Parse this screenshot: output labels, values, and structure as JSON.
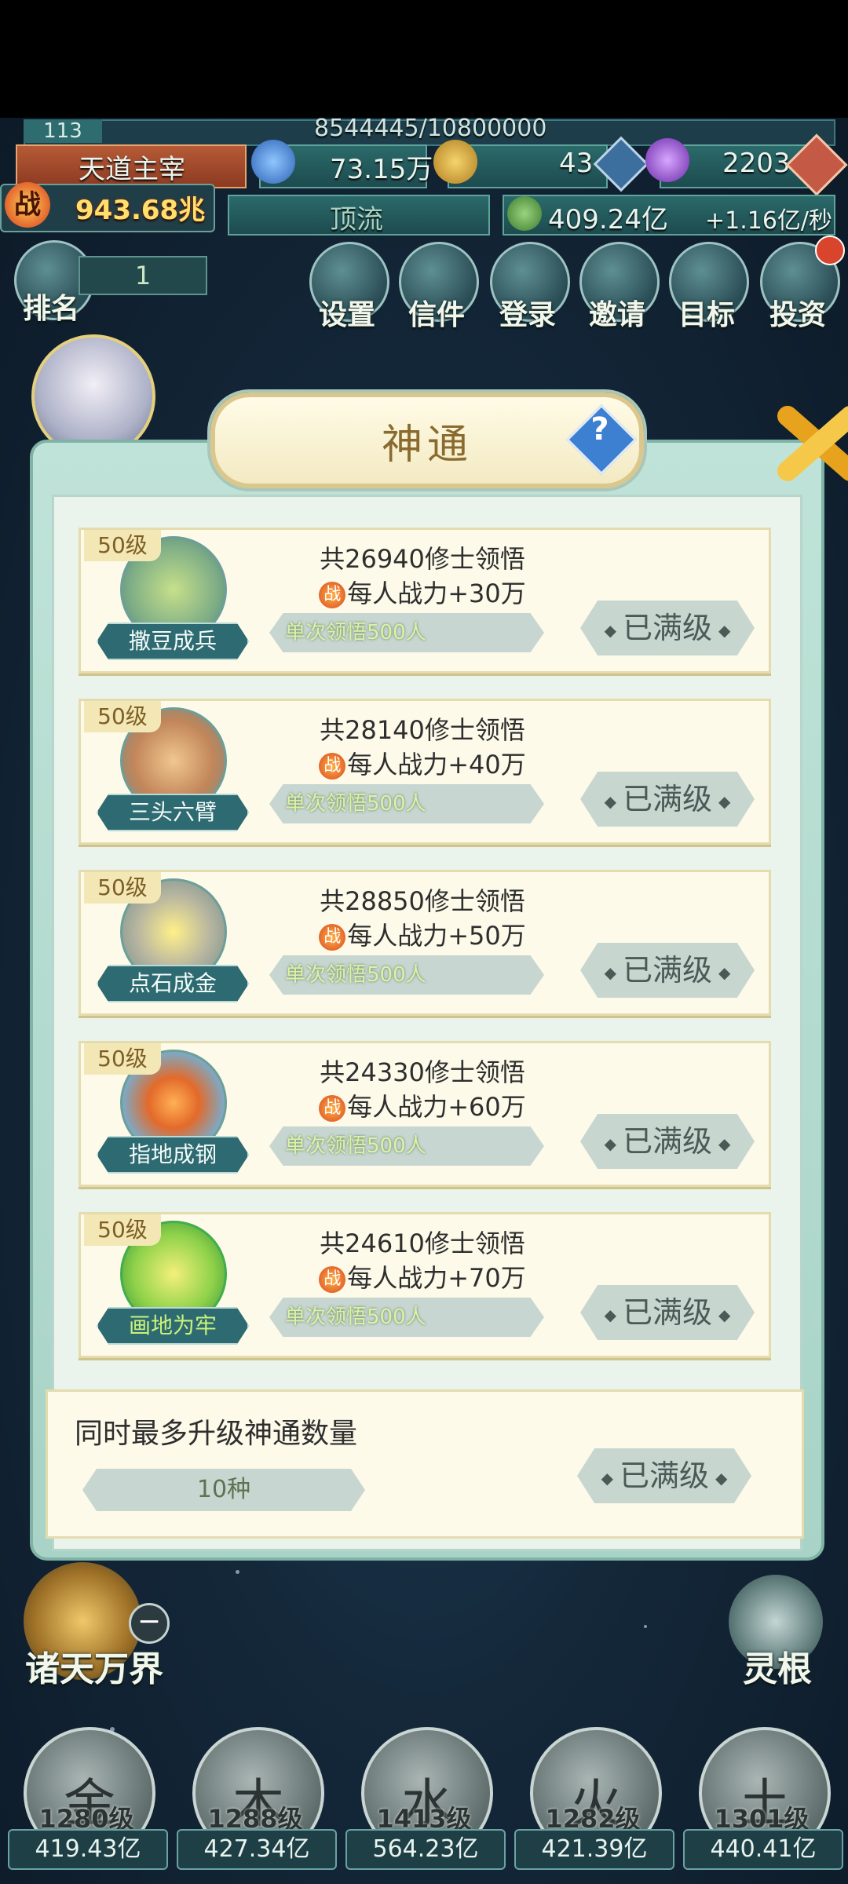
{
  "hud": {
    "player_level": "113",
    "exp": "8544445/10800000",
    "title": "天道主宰",
    "power_icon_text": "战",
    "power": "943.68兆",
    "resource1": "73.15万",
    "resource2": "43",
    "resource3": "2203",
    "rank_tier": "顶流",
    "gold": "409.24亿",
    "gold_rate": "+1.16亿/秒"
  },
  "top_menu": {
    "rank_label": "排名",
    "rank_value": "1",
    "items": [
      "设置",
      "信件",
      "登录",
      "邀请",
      "目标",
      "投资"
    ]
  },
  "modal": {
    "title": "神通",
    "help": "?",
    "cards": [
      {
        "level": "50级",
        "name": "撒豆成兵",
        "line1": "共26940修士领悟",
        "line2": "每人战力+30万",
        "pill": "单次领悟500人",
        "status": "已满级"
      },
      {
        "level": "50级",
        "name": "三头六臂",
        "line1": "共28140修士领悟",
        "line2": "每人战力+40万",
        "pill": "单次领悟500人",
        "status": "已满级"
      },
      {
        "level": "50级",
        "name": "点石成金",
        "line1": "共28850修士领悟",
        "line2": "每人战力+50万",
        "pill": "单次领悟500人",
        "status": "已满级"
      },
      {
        "level": "50级",
        "name": "指地成钢",
        "line1": "共24330修士领悟",
        "line2": "每人战力+60万",
        "pill": "单次领悟500人",
        "status": "已满级"
      },
      {
        "level": "50级",
        "name": "画地为牢",
        "line1": "共24610修士领悟",
        "line2": "每人战力+70万",
        "pill": "单次领悟500人",
        "status": "已满级"
      }
    ],
    "upgrade": {
      "title": "同时最多升级神通数量",
      "value": "10种",
      "status": "已满级"
    }
  },
  "side": {
    "left": "诸天万界",
    "right": "灵根"
  },
  "elements": [
    {
      "glyph": "金",
      "level": "1280级",
      "money": "419.43亿"
    },
    {
      "glyph": "木",
      "level": "1288级",
      "money": "427.34亿"
    },
    {
      "glyph": "水",
      "level": "1413级",
      "money": "564.23亿"
    },
    {
      "glyph": "火",
      "level": "1282级",
      "money": "421.39亿"
    },
    {
      "glyph": "土",
      "level": "1301级",
      "money": "440.41亿"
    }
  ]
}
